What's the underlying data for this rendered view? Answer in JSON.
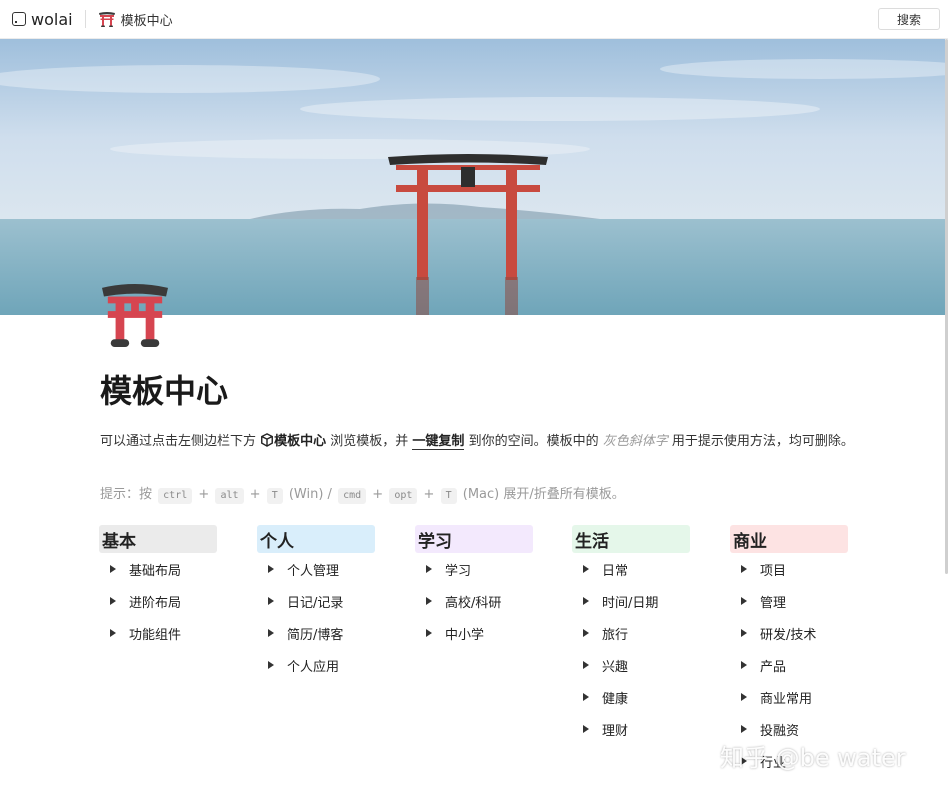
{
  "topbar": {
    "app_name": "wolai",
    "breadcrumb": "模板中心",
    "search_label": "搜索"
  },
  "page": {
    "title": "模板中心",
    "desc_part1": "可以通过点击左侧边栏下方 ",
    "desc_link_bold": "模板中心",
    "desc_part2": " 浏览模板，并 ",
    "desc_underlined": "一键复制",
    "desc_part3": " 到你的空间。模板中的 ",
    "desc_gray_italic": "灰色斜体字",
    "desc_part4": " 用于提示使用方法，均可删除。",
    "tip_prefix": "提示：按",
    "tip_key_ctrl": "ctrl",
    "tip_plus1": "+",
    "tip_key_alt": "alt",
    "tip_plus2": "+",
    "tip_key_t1": "T",
    "tip_win": "(Win) /",
    "tip_key_cmd": "cmd",
    "tip_plus3": "+",
    "tip_key_opt": "opt",
    "tip_plus4": "+",
    "tip_key_t2": "T",
    "tip_suffix": "(Mac) 展开/折叠所有模板。"
  },
  "categories": [
    {
      "name": "基本",
      "color": "#ebebeb",
      "items": [
        "基础布局",
        "进阶布局",
        "功能组件"
      ]
    },
    {
      "name": "个人",
      "color": "#d9eefb",
      "items": [
        "个人管理",
        "日记/记录",
        "简历/博客",
        "个人应用"
      ]
    },
    {
      "name": "学习",
      "color": "#f3e9fd",
      "items": [
        "学习",
        "高校/科研",
        "中小学"
      ]
    },
    {
      "name": "生活",
      "color": "#e5f7ea",
      "items": [
        "日常",
        "时间/日期",
        "旅行",
        "兴趣",
        "健康",
        "理财"
      ]
    },
    {
      "name": "商业",
      "color": "#fde3e3",
      "items": [
        "项目",
        "管理",
        "研发/技术",
        "产品",
        "商业常用",
        "投融资",
        "行业"
      ]
    }
  ],
  "watermark": "知乎 @be water",
  "colors": {
    "torii_red": "#d64550",
    "torii_dark": "#3a3a3a"
  }
}
